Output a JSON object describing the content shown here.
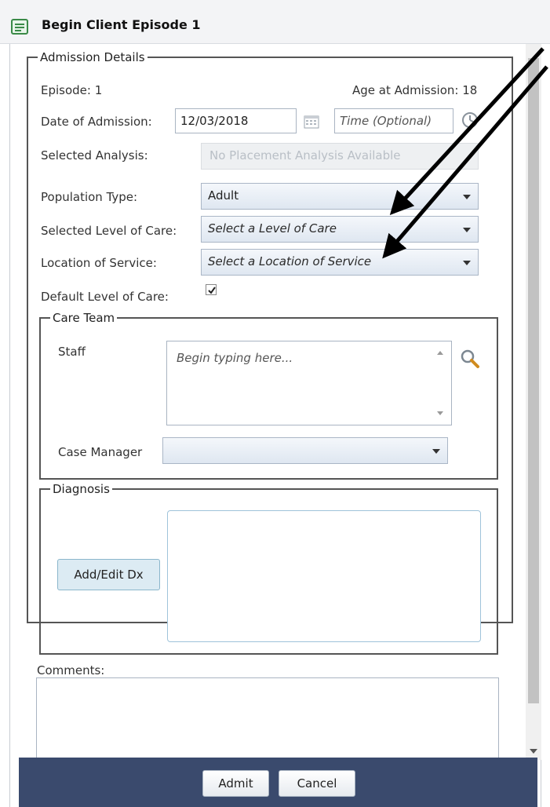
{
  "title": "Begin Client Episode 1",
  "admission": {
    "legend": "Admission Details",
    "episode": "Episode: 1",
    "age": "Age at Admission: 18",
    "date_label": "Date of Admission:",
    "date_value": "12/03/2018",
    "time_placeholder": "Time (Optional)",
    "analysis_label": "Selected Analysis:",
    "analysis_value": "No Placement Analysis Available",
    "population_label": "Population Type:",
    "population_value": "Adult",
    "level_label": "Selected Level of Care:",
    "level_value": "Select a Level of Care",
    "location_label": "Location of Service:",
    "location_value": "Select a Location of Service",
    "default_label": "Default Level of Care:",
    "default_checked": true
  },
  "care_team": {
    "legend": "Care Team",
    "staff_label": "Staff",
    "staff_placeholder": "Begin typing here...",
    "case_manager_label": "Case Manager",
    "case_manager_value": ""
  },
  "diagnosis": {
    "legend": "Diagnosis",
    "button": "Add/Edit Dx"
  },
  "comments": {
    "label": "Comments:"
  },
  "footer": {
    "admit": "Admit",
    "cancel": "Cancel"
  },
  "icons": {
    "title": "form-icon",
    "calendar": "calendar-icon",
    "clock": "clock-icon",
    "search": "magnifier-icon"
  },
  "colors": {
    "footer_bg": "#3a4a6d",
    "accent_green": "#3a8a48"
  }
}
